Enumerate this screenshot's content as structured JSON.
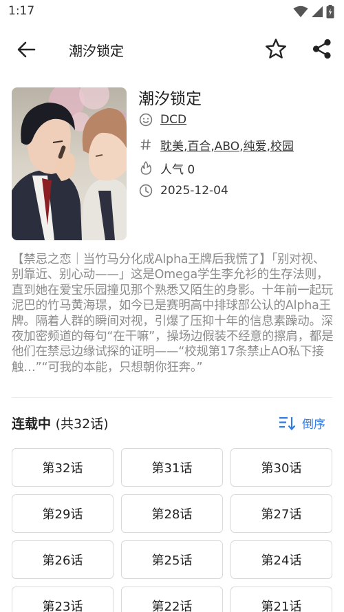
{
  "status_bar": {
    "time": "1:17",
    "icons": [
      "wifi-icon",
      "signal-icon",
      "battery-icon"
    ]
  },
  "app_bar": {
    "title": "潮汐锁定",
    "back_icon": "arrow-back-icon",
    "favorite_icon": "star-outline-icon",
    "share_icon": "share-icon"
  },
  "book": {
    "title": "潮汐锁定",
    "author": "DCD",
    "tags": "耽美,百合,ABO,纯爱,校园",
    "popularity": "人气 0",
    "date": "2025-12-04",
    "description": "【禁忌之恋｜当竹马分化成Alpha王牌后我慌了】「别对视、别靠近、别心动——」这是Omega学生李允衫的生存法则，直到她在爱宝乐园撞见那个熟悉又陌生的身影。十年前一起玩泥巴的竹马黄海璟，如今已是赛明高中排球部公认的Alpha王牌。隔着人群的瞬间对视，引爆了压抑十年的信息素躁动。深夜加密频道的每句“在干嘛”，操场边假装不经意的擦肩，都是他们在禁忌边缘试探的证明——“校规第17条禁止AO私下接触…”“可我的本能，只想朝你狂奔。”"
  },
  "chapters": {
    "status": "连载中",
    "count_label": "(共32话)",
    "sort_label": "倒序",
    "sort_icon": "sort-descending-icon",
    "items": [
      "第32话",
      "第31话",
      "第30话",
      "第29话",
      "第28话",
      "第27话",
      "第26话",
      "第25话",
      "第24话",
      "第23话",
      "第22话",
      "第21话"
    ]
  },
  "colors": {
    "accent": "#2f7ae5",
    "description_text": "#8c8c8c",
    "button_border": "#d9d9d9"
  }
}
